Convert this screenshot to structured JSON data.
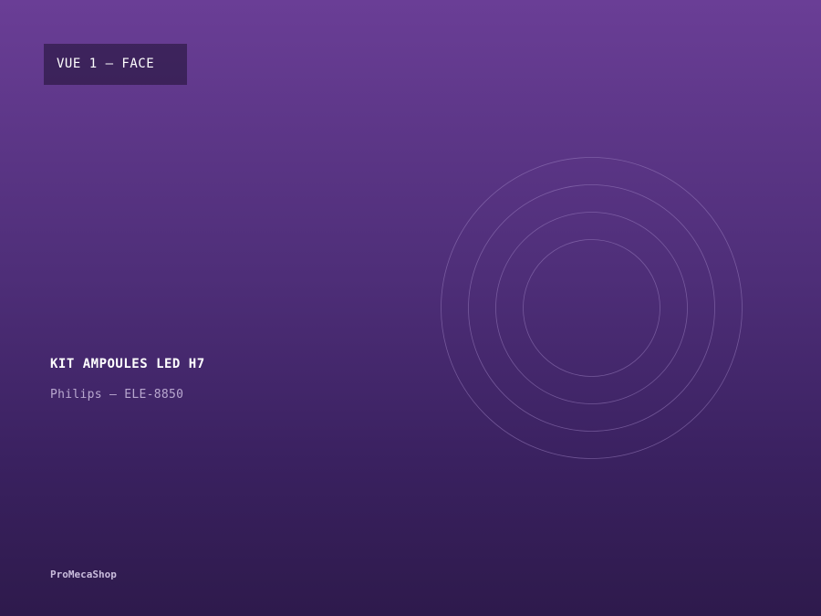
{
  "view_label": "VUE 1 — FACE",
  "product": {
    "title": "KIT AMPOULES LED H7",
    "subtitle": "Philips — ELE-8850"
  },
  "brand": "ProMecaShop",
  "colors": {
    "background_top": "#6a3e96",
    "background_bottom": "#2e1a4c",
    "badge_background": "#2a1844",
    "text_primary": "#ffffff",
    "text_secondary": "#b9a8cf",
    "ring_stroke": "#9a7fc0"
  }
}
